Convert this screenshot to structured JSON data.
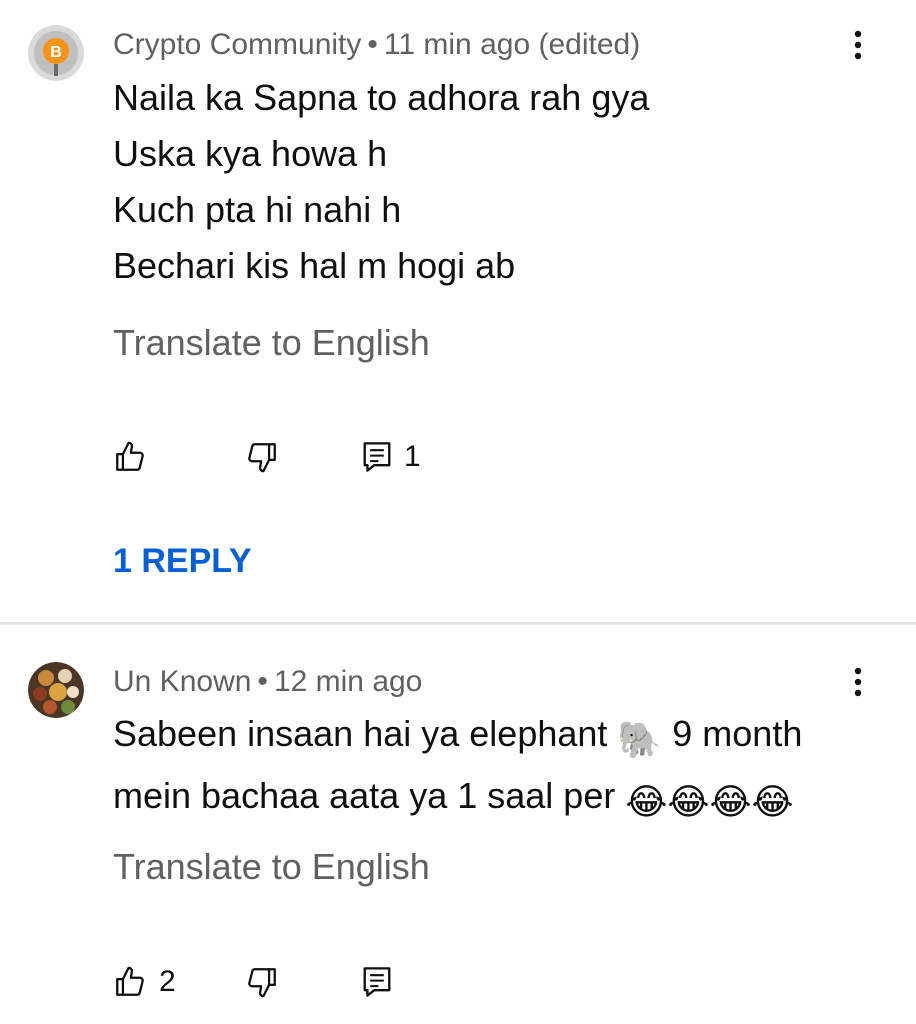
{
  "comments": [
    {
      "author": "Crypto Community",
      "separator": "•",
      "time": "11 min ago (edited)",
      "avatar_icon": "bitcoin-icon",
      "avatar_letter": "B",
      "lines": [
        "Naila ka Sapna to adhora rah gya",
        "Uska kya howa h",
        "Kuch pta hi nahi h",
        "Bechari kis hal m hogi ab"
      ],
      "translate_label": "Translate to English",
      "likes": "",
      "reply_count": "1",
      "replies_link": "1 REPLY"
    },
    {
      "author": "Un Known",
      "separator": "•",
      "time": "12 min ago",
      "avatar_icon": "food-photo-avatar",
      "line1_text": "Sabeen insaan hai ya elephant",
      "line1_after": "9 month",
      "line2_text": "mein bachaa aata ya 1 saal per",
      "emoji_elephant": "🐘",
      "emoji_laugh": "😂😂😂😂",
      "translate_label": "Translate to English",
      "likes": "2",
      "reply_count": ""
    }
  ],
  "colors": {
    "link_blue": "#065fd4",
    "meta_gray": "#606060",
    "avatar_orange": "#f7931a"
  }
}
